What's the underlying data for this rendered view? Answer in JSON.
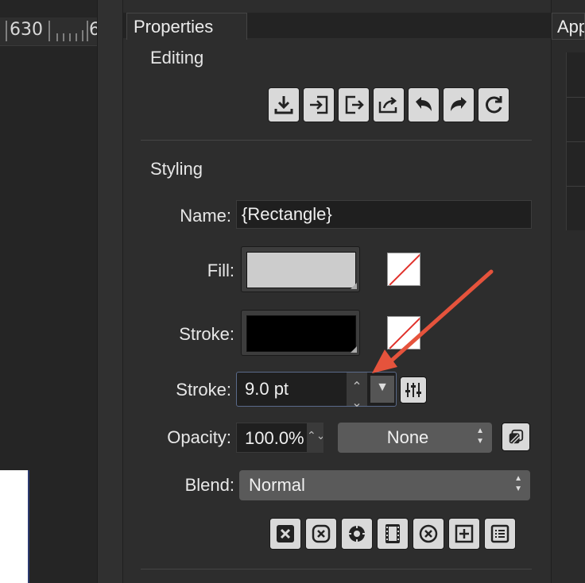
{
  "ruler": {
    "label_left": "630",
    "label_right": "6"
  },
  "panel": {
    "tab_label": "Properties",
    "editing": {
      "title": "Editing"
    },
    "styling": {
      "title": "Styling",
      "name_label": "Name:",
      "name_value": "{Rectangle}",
      "fill_label": "Fill:",
      "fill_color": "#cccccc",
      "stroke_color_label": "Stroke:",
      "stroke_color": "#000000",
      "stroke_width_label": "Stroke:",
      "stroke_width_value": "9.0 pt",
      "opacity_label": "Opacity:",
      "opacity_value": "100.0%",
      "opacity_mode": "None",
      "blend_label": "Blend:",
      "blend_value": "Normal"
    }
  },
  "right_panel": {
    "tab_label": "App"
  },
  "icons": {
    "editing_toolbar": [
      "download-icon",
      "import-icon",
      "export-icon",
      "share-icon",
      "undo-icon",
      "redo-icon",
      "refresh-icon"
    ],
    "bottom_toolbar": [
      "delete-icon",
      "clear-icon",
      "gear-icon",
      "film-icon",
      "cancel-icon",
      "add-box-icon",
      "list-icon"
    ]
  },
  "colors": {
    "annotation_arrow": "#e5533c",
    "focus_border": "#5a6a8a"
  }
}
